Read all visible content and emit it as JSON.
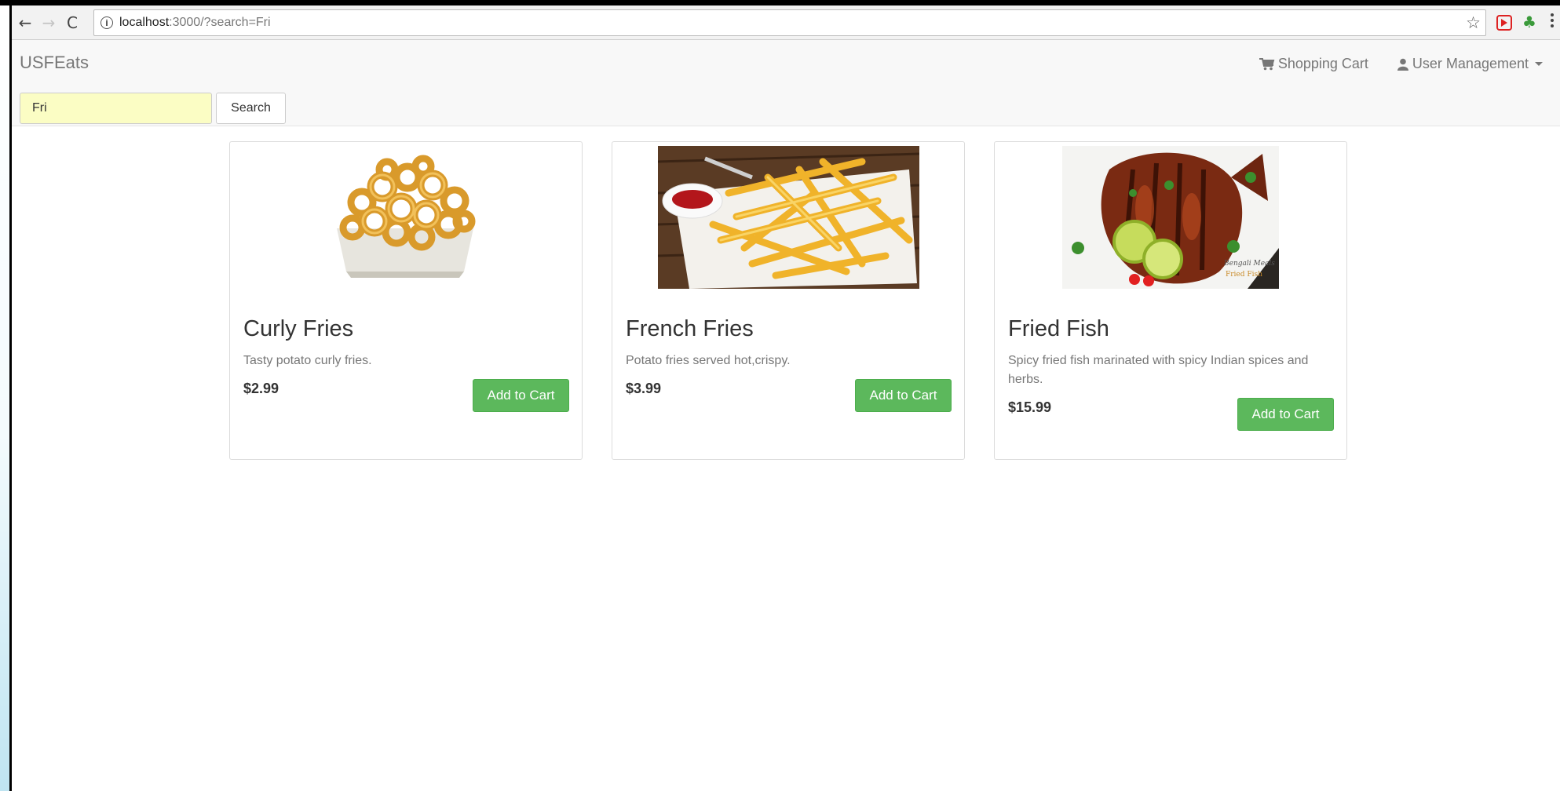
{
  "browser": {
    "url_host": "localhost",
    "url_path": ":3000/?search=Fri"
  },
  "navbar": {
    "brand": "USFEats",
    "cart_label": "Shopping Cart",
    "user_label": "User Management"
  },
  "search": {
    "value": "Fri",
    "button_label": "Search"
  },
  "products": [
    {
      "name": "Curly Fries",
      "description": "Tasty potato curly fries.",
      "price": "$2.99",
      "button": "Add to Cart"
    },
    {
      "name": "French Fries",
      "description": "Potato fries served hot,crispy.",
      "price": "$3.99",
      "button": "Add to Cart"
    },
    {
      "name": "Fried Fish",
      "description": "Spicy fried fish marinated with spicy Indian spices and herbs.",
      "price": "$15.99",
      "button": "Add to Cart"
    }
  ],
  "image_watermark": "Bengali Meals Fried Fish",
  "colors": {
    "accent_green": "#5cb85c",
    "search_bg": "#fbfdc4",
    "navbar_bg": "#f8f8f8"
  }
}
